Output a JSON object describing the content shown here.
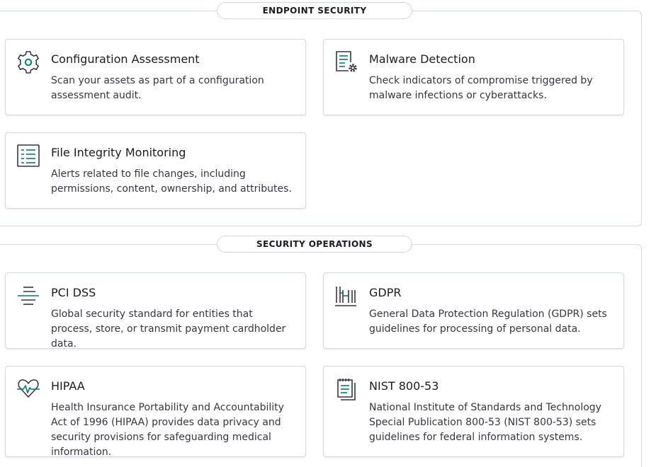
{
  "sections": {
    "endpoint": {
      "title": "ENDPOINT SECURITY",
      "cards": [
        {
          "title": "Configuration Assessment",
          "description": "Scan your assets as part of a configuration assessment audit.",
          "icon": "gear-icon"
        },
        {
          "title": "Malware Detection",
          "description": "Check indicators of compromise triggered by malware infections or cyberattacks.",
          "icon": "document-gear-icon"
        },
        {
          "title": "File Integrity Monitoring",
          "description": "Alerts related to file changes, including permissions, content, ownership, and attributes.",
          "icon": "list-document-icon"
        }
      ]
    },
    "ops": {
      "title": "SECURITY OPERATIONS",
      "cards": [
        {
          "title": "PCI DSS",
          "description": "Global security standard for entities that process, store, or transmit payment cardholder data.",
          "icon": "strikethrough-lines-icon"
        },
        {
          "title": "GDPR",
          "description": "General Data Protection Regulation (GDPR) sets guidelines for processing of personal data.",
          "icon": "building-columns-icon"
        },
        {
          "title": "HIPAA",
          "description": "Health Insurance Portability and Accountability Act of 1996 (HIPAA) provides data privacy and security provisions for safeguarding medical information.",
          "icon": "heart-pulse-icon"
        },
        {
          "title": "NIST 800-53",
          "description": "National Institute of Standards and Technology Special Publication 800-53 (NIST 800-53) sets guidelines for federal information systems.",
          "icon": "notepad-icon"
        }
      ]
    }
  },
  "colors": {
    "icon_dark": "#343741",
    "icon_accent": "#017d73",
    "border": "#d3dae6"
  }
}
